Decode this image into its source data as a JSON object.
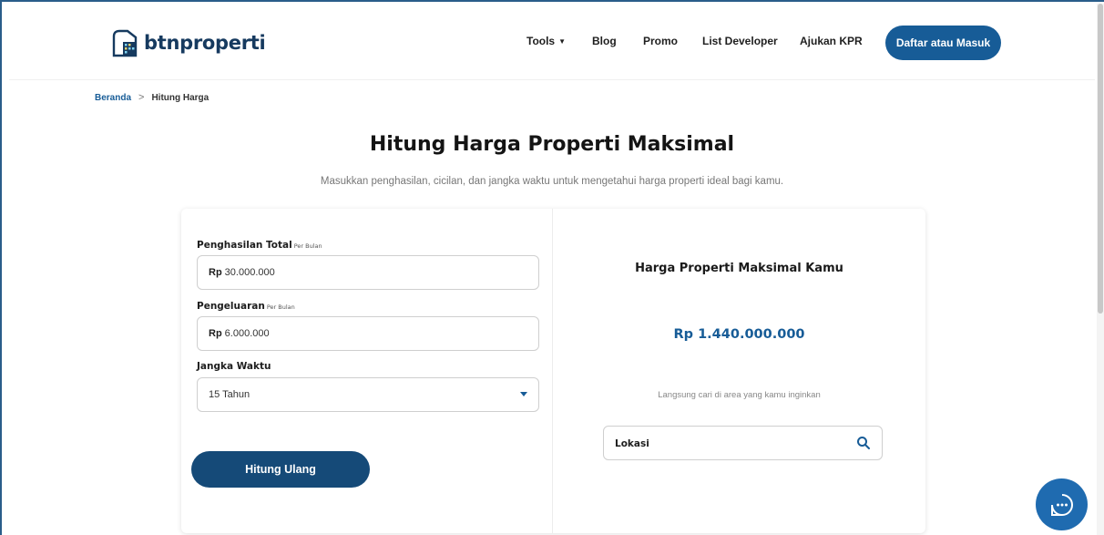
{
  "header": {
    "logo_text": "btnproperti",
    "nav": [
      {
        "label": "Tools",
        "has_dropdown": true
      },
      {
        "label": "Blog"
      },
      {
        "label": "Promo"
      },
      {
        "label": "List Developer"
      },
      {
        "label": "Ajukan KPR"
      }
    ],
    "cta_label": "Daftar atau Masuk"
  },
  "breadcrumb": {
    "home": "Beranda",
    "separator": ">",
    "current": "Hitung Harga"
  },
  "page": {
    "title": "Hitung Harga Properti Maksimal",
    "subtitle": "Masukkan penghasilan, cicilan, dan jangka waktu untuk mengetahui harga properti ideal bagi kamu."
  },
  "form": {
    "income": {
      "label": "Penghasilan Total",
      "sublabel": "Per Bulan",
      "prefix": "Rp",
      "value": "30.000.000"
    },
    "expense": {
      "label": "Pengeluaran",
      "sublabel": "Per Bulan",
      "prefix": "Rp",
      "value": "6.000.000"
    },
    "term": {
      "label": "Jangka Waktu",
      "selected": "15 Tahun"
    },
    "submit_label": "Hitung Ulang"
  },
  "result": {
    "title": "Harga Properti Maksimal Kamu",
    "value": "Rp 1.440.000.000",
    "hint": "Langsung cari di area yang kamu inginkan",
    "location_placeholder": "Lokasi"
  },
  "colors": {
    "brand": "#175c97",
    "brand_dark": "#154a78",
    "chat": "#1f6bb0"
  },
  "icons": {
    "search": "search-icon",
    "chat": "chat-icon",
    "logo": "house-logo-icon"
  }
}
